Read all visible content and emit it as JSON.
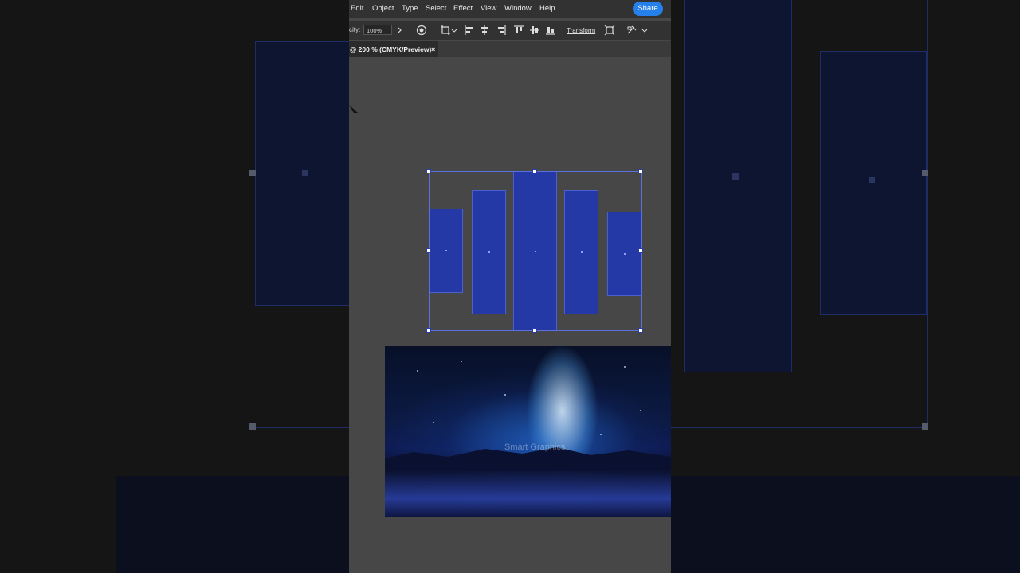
{
  "menu": {
    "items": [
      "Edit",
      "Object",
      "Type",
      "Select",
      "Effect",
      "View",
      "Window",
      "Help"
    ],
    "share_label": "Share"
  },
  "options_bar": {
    "opacity_label": "city:",
    "opacity_value": "100%",
    "transform_label": "Transform"
  },
  "document": {
    "tab_label": "@ 200 % (CMYK/Preview)",
    "close_glyph": "×"
  },
  "artwork": {
    "image_watermark": "Smart Graphics"
  },
  "colors": {
    "accent": "#2680eb",
    "shape_fill": "#2539a6",
    "selection": "#5a6fe0",
    "canvas": "#474747"
  }
}
